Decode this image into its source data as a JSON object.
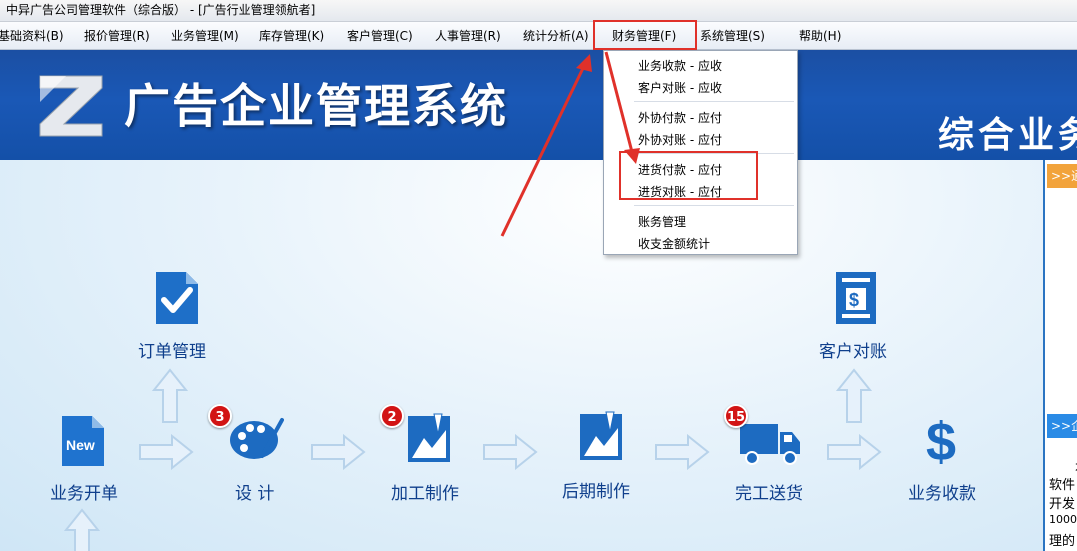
{
  "window": {
    "title": "中异广告公司管理软件（综合版） - [广告行业管理领航者]"
  },
  "menu": [
    {
      "label": "基础资料(B)"
    },
    {
      "label": "报价管理(R)"
    },
    {
      "label": "业务管理(M)"
    },
    {
      "label": "库存管理(K)"
    },
    {
      "label": "客户管理(C)"
    },
    {
      "label": "人事管理(R)"
    },
    {
      "label": "统计分析(A)"
    },
    {
      "label": "财务管理(F)"
    },
    {
      "label": "系统管理(S)"
    },
    {
      "label": "帮助(H)"
    }
  ],
  "dropdown": {
    "items": [
      "业务收款 - 应收",
      "客户对账 - 应收",
      "外协付款 - 应付",
      "外协对账 - 应付",
      "进货付款 - 应付",
      "进货对账 - 应付",
      "账务管理",
      "收支金额统计"
    ]
  },
  "banner": {
    "title": "广告企业管理系统",
    "tagline": "综合业务"
  },
  "flow": {
    "order_mgmt": "订单管理",
    "business_start": "业务开单",
    "design": "设  计",
    "processing": "加工制作",
    "post_production": "后期制作",
    "delivery": "完工送货",
    "collection": "业务收款",
    "customer_reconcile": "客户对账",
    "new_icon_text": "New"
  },
  "badges": {
    "design": "3",
    "processing": "2",
    "delivery": "15"
  },
  "right_panel": {
    "header1": ">>通",
    "header2": ">>企",
    "text_lines": [
      "本",
      "软件",
      "开发",
      "1000",
      "理的"
    ]
  },
  "colors": {
    "highlight": "#e0312a",
    "banner": "#1a58b6",
    "label": "#0f3f8c",
    "badge": "#d21414"
  }
}
